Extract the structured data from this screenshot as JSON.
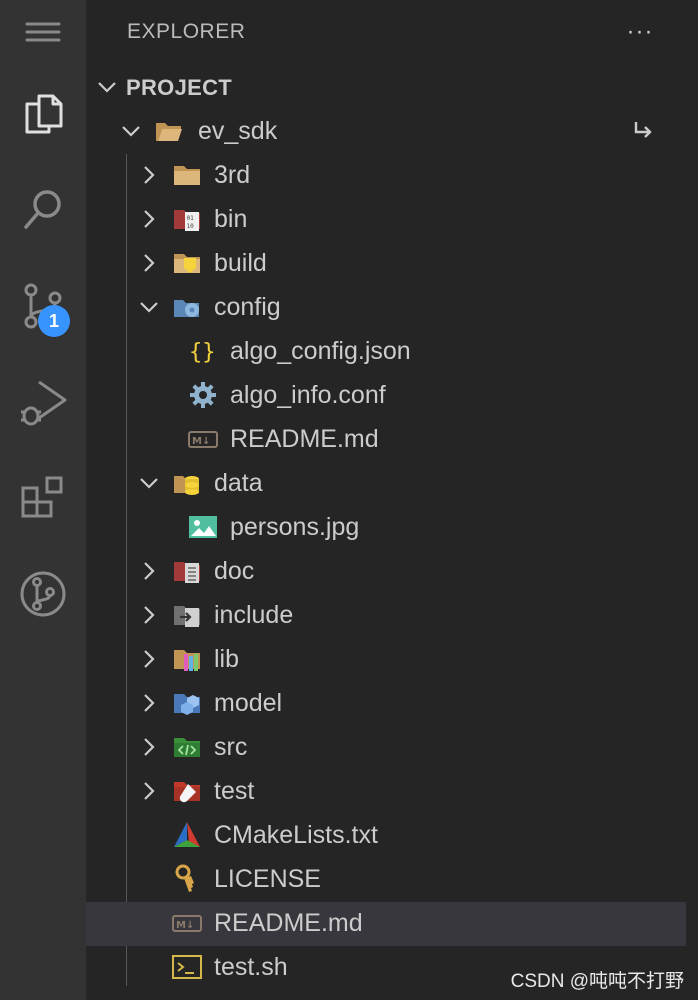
{
  "sidebar": {
    "title": "EXPLORER",
    "more_label": "···",
    "section": "PROJECT",
    "root": "ev_sdk"
  },
  "activity": {
    "badge": "1",
    "items": [
      "explorer-icon",
      "search-icon",
      "source-control-icon",
      "run-debug-icon",
      "extensions-icon",
      "git-graph-icon"
    ]
  },
  "tree": [
    {
      "name": "3rd",
      "icon": "folder-icon"
    },
    {
      "name": "bin",
      "icon": "bin-folder-icon"
    },
    {
      "name": "build",
      "icon": "build-folder-icon"
    },
    {
      "name": "config",
      "icon": "config-folder-icon"
    },
    {
      "name": "algo_config.json",
      "icon": "json-icon"
    },
    {
      "name": "algo_info.conf",
      "icon": "gear-icon"
    },
    {
      "name": "README.md",
      "icon": "markdown-icon"
    },
    {
      "name": "data",
      "icon": "data-folder-icon"
    },
    {
      "name": "persons.jpg",
      "icon": "image-icon"
    },
    {
      "name": "doc",
      "icon": "doc-folder-icon"
    },
    {
      "name": "include",
      "icon": "include-folder-icon"
    },
    {
      "name": "lib",
      "icon": "lib-folder-icon"
    },
    {
      "name": "model",
      "icon": "model-folder-icon"
    },
    {
      "name": "src",
      "icon": "src-folder-icon"
    },
    {
      "name": "test",
      "icon": "test-folder-icon"
    },
    {
      "name": "CMakeLists.txt",
      "icon": "cmake-icon"
    },
    {
      "name": "LICENSE",
      "icon": "license-icon"
    },
    {
      "name": "README.md",
      "icon": "markdown-icon"
    },
    {
      "name": "test.sh",
      "icon": "shell-icon"
    }
  ],
  "watermark": "CSDN @吨吨不打野",
  "colors": {
    "accent": "#3794ff",
    "selected_row": "#37373d",
    "activity_bar": "#333333",
    "sidebar": "#252526"
  }
}
